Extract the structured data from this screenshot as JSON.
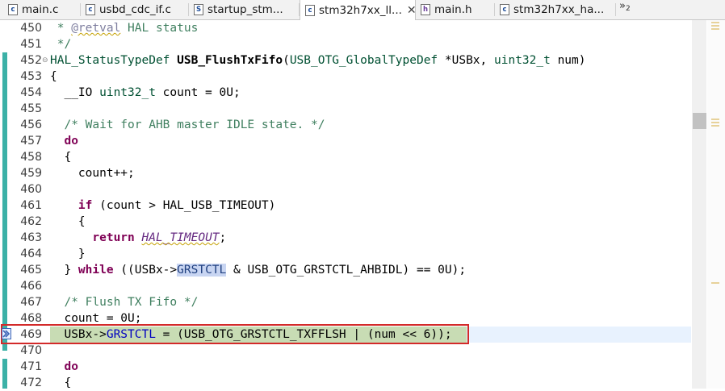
{
  "tabs": [
    {
      "label": "main.c",
      "icon": "c-file-icon",
      "glyph": "c",
      "active": false
    },
    {
      "label": "usbd_cdc_if.c",
      "icon": "c-file-icon",
      "glyph": "c",
      "active": false
    },
    {
      "label": "startup_stm...",
      "icon": "s-file-icon",
      "glyph": "S",
      "active": false
    },
    {
      "label": "stm32h7xx_ll...",
      "icon": "c-file-icon",
      "glyph": "c",
      "active": true,
      "close": "✕"
    },
    {
      "label": "main.h",
      "icon": "h-file-icon",
      "glyph": "h",
      "active": false
    },
    {
      "label": "stm32h7xx_ha...",
      "icon": "c-file-icon",
      "glyph": "c",
      "active": false
    }
  ],
  "tabs_overflow": {
    "label": "»",
    "count": "2"
  },
  "lines": [
    {
      "num": "450",
      "code": [
        [
          "cm",
          " * "
        ],
        [
          "tg",
          "@retval"
        ],
        [
          "cm",
          " HAL status"
        ]
      ]
    },
    {
      "num": "451",
      "code": [
        [
          "cm",
          " */"
        ]
      ]
    },
    {
      "num": "452",
      "fold": "⊖",
      "code": [
        [
          "ty",
          "HAL_StatusTypeDef"
        ],
        [
          "",
          ""
        ],
        [
          "fn",
          " USB_FlushTxFifo"
        ],
        [
          "",
          "("
        ],
        [
          "ty",
          "USB_OTG_GlobalTypeDef"
        ],
        [
          "",
          " *USBx, "
        ],
        [
          "ty",
          "uint32_t"
        ],
        [
          "",
          " num)"
        ]
      ]
    },
    {
      "num": "453",
      "code": [
        [
          "",
          "{"
        ]
      ]
    },
    {
      "num": "454",
      "code": [
        [
          "",
          "  __IO "
        ],
        [
          "ty",
          "uint32_t"
        ],
        [
          "",
          " count = 0U;"
        ]
      ]
    },
    {
      "num": "455",
      "code": []
    },
    {
      "num": "456",
      "code": [
        [
          "cm",
          "  /* Wait for AHB master IDLE state. */"
        ]
      ]
    },
    {
      "num": "457",
      "code": [
        [
          "kw",
          "  do"
        ]
      ]
    },
    {
      "num": "458",
      "code": [
        [
          "",
          "  {"
        ]
      ]
    },
    {
      "num": "459",
      "code": [
        [
          "",
          "    count++;"
        ]
      ]
    },
    {
      "num": "460",
      "code": []
    },
    {
      "num": "461",
      "code": [
        [
          "kw",
          "    if"
        ],
        [
          "",
          " (count > HAL_USB_TIMEOUT)"
        ]
      ]
    },
    {
      "num": "462",
      "code": [
        [
          "",
          "    {"
        ]
      ]
    },
    {
      "num": "463",
      "code": [
        [
          "kw",
          "      return"
        ],
        [
          "",
          " "
        ],
        [
          "mc",
          "HAL_TIMEOUT"
        ],
        [
          "",
          ";"
        ]
      ]
    },
    {
      "num": "464",
      "code": [
        [
          "",
          "    }"
        ]
      ]
    },
    {
      "num": "465",
      "code": [
        [
          "",
          "  } "
        ],
        [
          "kw",
          "while"
        ],
        [
          "",
          " ((USBx->"
        ],
        [
          "occ",
          "GRSTCTL"
        ],
        [
          "",
          " & USB_OTG_GRSTCTL_AHBIDL) == 0U);"
        ]
      ]
    },
    {
      "num": "466",
      "code": []
    },
    {
      "num": "467",
      "code": [
        [
          "cm",
          "  /* Flush TX Fifo */"
        ]
      ]
    },
    {
      "num": "468",
      "code": [
        [
          "",
          "  count = 0U;"
        ]
      ]
    },
    {
      "num": "469",
      "code": [
        [
          "",
          "  USBx->"
        ],
        [
          "field",
          "GRSTCTL"
        ],
        [
          "",
          " = (USB_OTG_GRSTCTL_TXFFLSH | (num << 6));"
        ]
      ]
    },
    {
      "num": "470",
      "code": []
    },
    {
      "num": "471",
      "code": [
        [
          "kw",
          "  do"
        ]
      ]
    },
    {
      "num": "472",
      "code": [
        [
          "",
          "  {"
        ]
      ]
    }
  ],
  "current_line": "469",
  "colors": {
    "keyword": "#7f0055",
    "comment": "#3f7f5f",
    "type": "#005032",
    "highlight_box": "#d32a2a",
    "current_line": "#c8dcb4",
    "ruler_band": "#3cb1a7"
  }
}
